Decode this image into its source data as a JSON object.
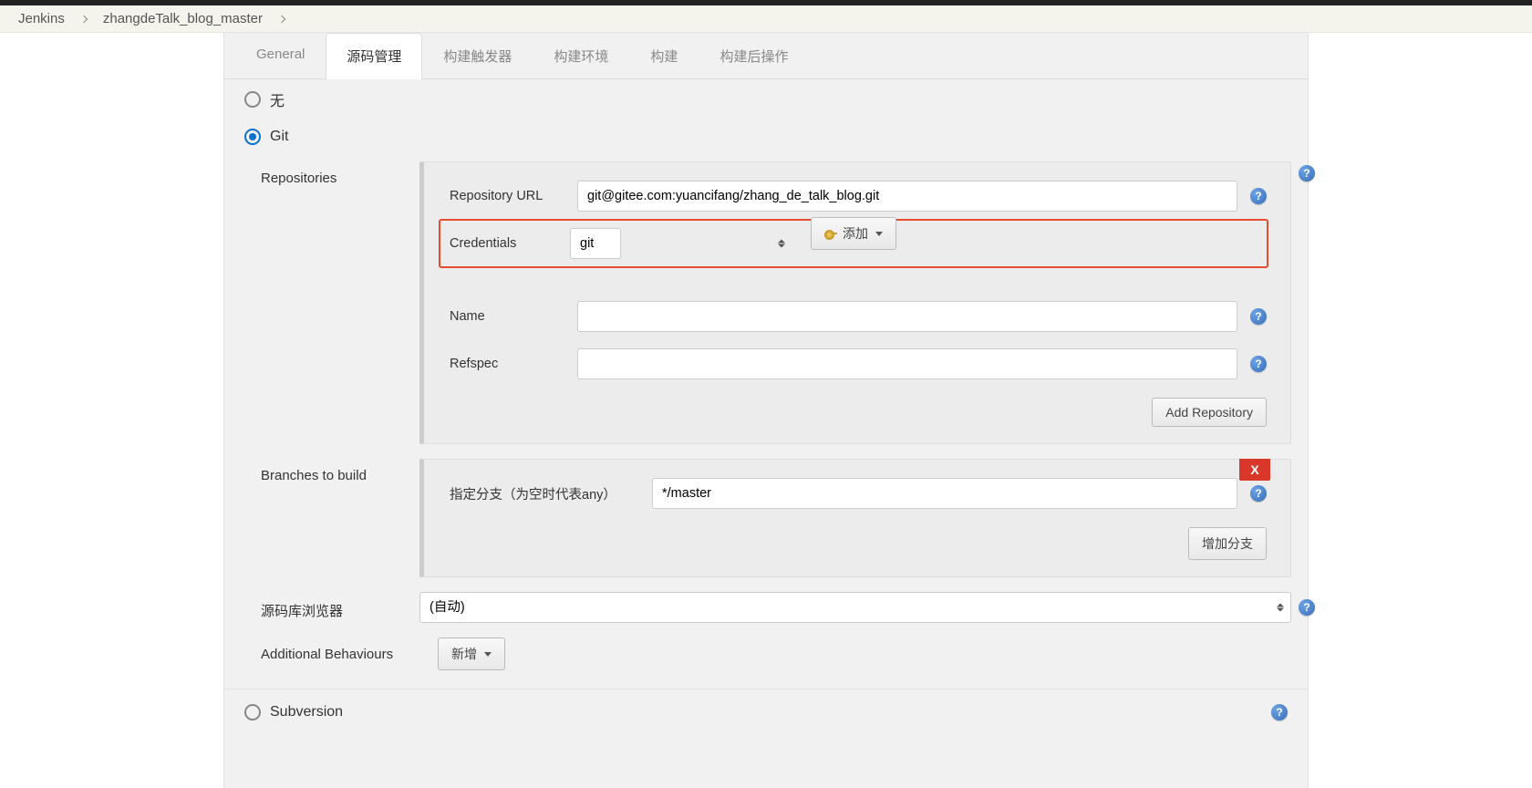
{
  "breadcrumb": {
    "root": "Jenkins",
    "job": "zhangdeTalk_blog_master"
  },
  "tabs": {
    "general": "General",
    "scm": "源码管理",
    "triggers": "构建触发器",
    "env": "构建环境",
    "build": "构建",
    "post": "构建后操作"
  },
  "section_title": "源码管理",
  "scm_options": {
    "none": "无",
    "git": "Git",
    "subversion": "Subversion"
  },
  "repositories": {
    "label": "Repositories",
    "url_label": "Repository URL",
    "url_value": "git@gitee.com:yuancifang/zhang_de_talk_blog.git",
    "cred_label": "Credentials",
    "cred_value": "git",
    "add_label": "添加",
    "name_label": "Name",
    "name_value": "",
    "refspec_label": "Refspec",
    "refspec_value": "",
    "add_repo": "Add Repository"
  },
  "branches": {
    "label": "Branches to build",
    "branch_label": "指定分支（为空时代表any）",
    "branch_value": "*/master",
    "add_branch": "增加分支",
    "delete": "X"
  },
  "repo_browser": {
    "label": "源码库浏览器",
    "value": "(自动)"
  },
  "additional": {
    "label": "Additional Behaviours",
    "add": "新增"
  },
  "help": "?"
}
